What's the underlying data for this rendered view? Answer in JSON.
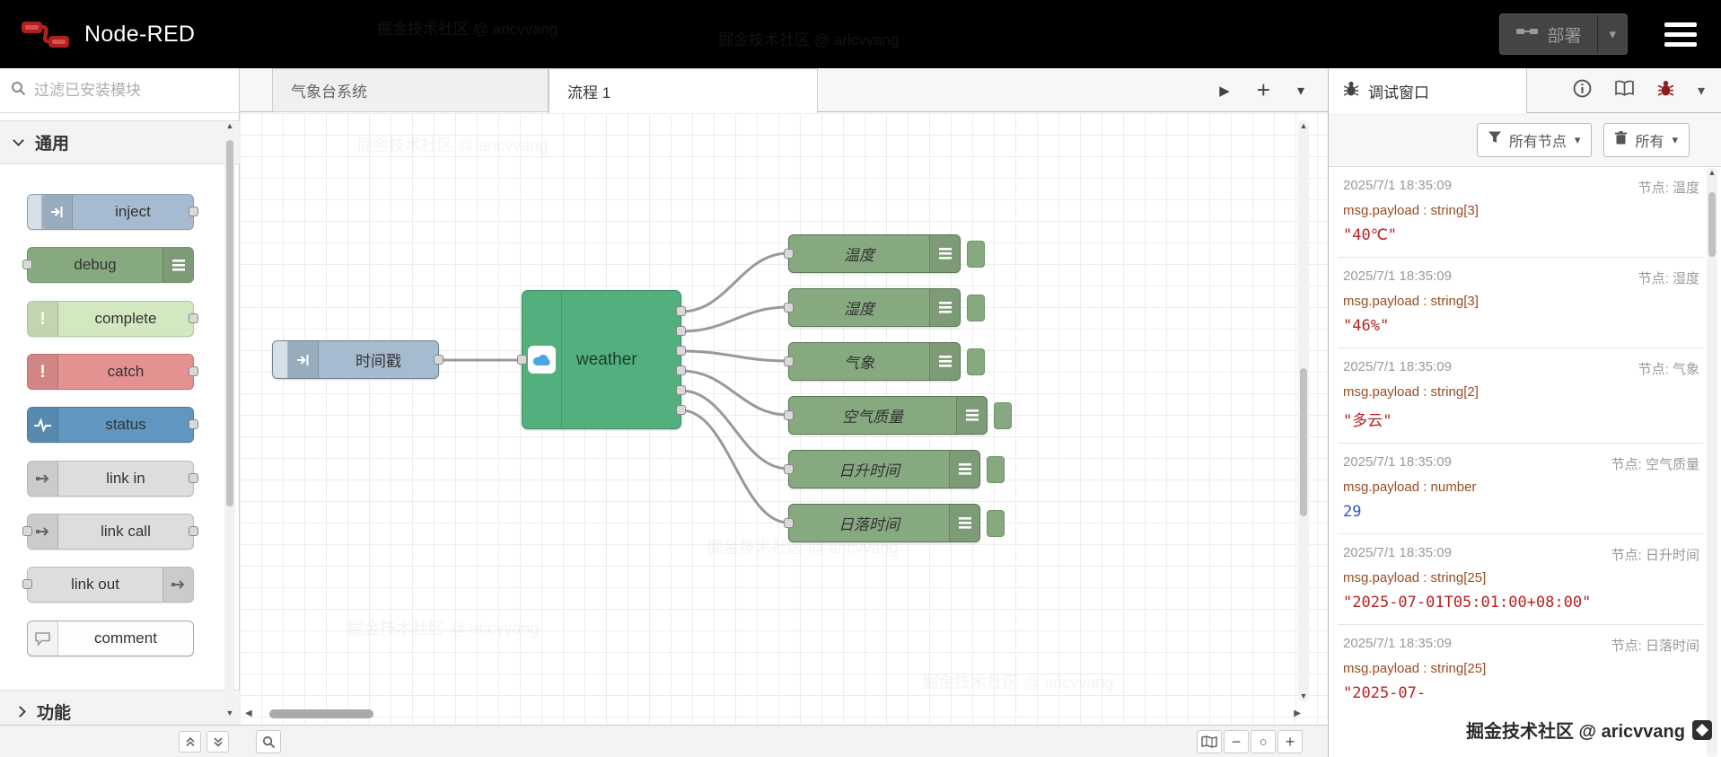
{
  "colors": {
    "header_bg": "#000000",
    "logo_red": "#b02020",
    "inject": "#a6bbcf",
    "debug": "#87a980",
    "complete": "#d2e8c0",
    "catch": "#e49191",
    "status": "#6096bf",
    "link": "#dddddd",
    "comment": "#fdfdfd",
    "weather": "#52af7e",
    "wire": "#999999",
    "string_value": "#b82121",
    "number_value": "#2c55c8",
    "meta_text": "#9a4b21"
  },
  "header": {
    "title": "Node-RED",
    "deploy_label": "部署"
  },
  "palette": {
    "search_placeholder": "过滤已安装模块",
    "categories": [
      {
        "label": "通用"
      },
      {
        "label": "功能"
      }
    ],
    "items": [
      {
        "label": "inject"
      },
      {
        "label": "debug"
      },
      {
        "label": "complete"
      },
      {
        "label": "catch"
      },
      {
        "label": "status"
      },
      {
        "label": "link in"
      },
      {
        "label": "link call"
      },
      {
        "label": "link out"
      },
      {
        "label": "comment"
      }
    ]
  },
  "workspace": {
    "tabs": [
      {
        "label": "气象台系统"
      },
      {
        "label": "流程 1"
      }
    ]
  },
  "flow": {
    "inject_label": "时间戳",
    "weather_label": "weather",
    "debug_labels": [
      "温度",
      "湿度",
      "气象",
      "空气质量",
      "日升时间",
      "日落时间"
    ]
  },
  "sidebar": {
    "tab_label": "调试窗口",
    "filter_nodes_label": "所有节点",
    "clear_label": "所有",
    "messages": [
      {
        "time": "2025/7/1 18:35:09",
        "node": "节点: 温度",
        "meta": "msg.payload : string[3]",
        "value": "\"40℃\"",
        "type": "string"
      },
      {
        "time": "2025/7/1 18:35:09",
        "node": "节点: 湿度",
        "meta": "msg.payload : string[3]",
        "value": "\"46%\"",
        "type": "string"
      },
      {
        "time": "2025/7/1 18:35:09",
        "node": "节点: 气象",
        "meta": "msg.payload : string[2]",
        "value": "\"多云\"",
        "type": "string"
      },
      {
        "time": "2025/7/1 18:35:09",
        "node": "节点: 空气质量",
        "meta": "msg.payload : number",
        "value": "29",
        "type": "number"
      },
      {
        "time": "2025/7/1 18:35:09",
        "node": "节点: 日升时间",
        "meta": "msg.payload : string[25]",
        "value": "\"2025-07-01T05:01:00+08:00\"",
        "type": "string"
      },
      {
        "time": "2025/7/1 18:35:09",
        "node": "节点: 日落时间",
        "meta": "msg.payload : string[25]",
        "value": "\"2025-07-",
        "type": "string"
      }
    ]
  },
  "watermark": {
    "text": "掘金技术社区 @ aricvvang"
  }
}
